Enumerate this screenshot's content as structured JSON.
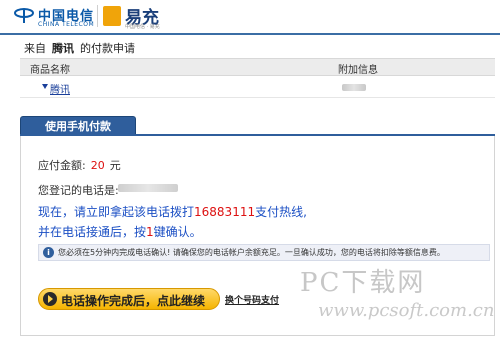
{
  "header": {
    "telecom_name": "中国电信",
    "telecom_en": "CHINA TELECOM",
    "yichong_name": "易充",
    "yichong_sub": "中国电信 · 易充"
  },
  "merchant": {
    "prefix": "来自",
    "name": "腾讯",
    "suffix": "的付款申请"
  },
  "table": {
    "columns": [
      "商品名称",
      "附加信息"
    ],
    "row": {
      "product_link": "腾讯"
    }
  },
  "tab": {
    "label": "使用手机付款"
  },
  "payment": {
    "amount_label": "应付金额:",
    "amount_value": "20",
    "amount_unit": "元",
    "phone_label": "您登记的电话是:"
  },
  "instructions": {
    "line1_prefix": "现在，请立即拿起该电话拨打",
    "hotline_number": "16883111",
    "line1_suffix": "支付热线,",
    "line2_prefix": "并在电话接通后，按",
    "key": "1",
    "line2_suffix": "键确认。"
  },
  "notice": {
    "icon_text": "i",
    "text": "您必须在5分钟内完成电话确认! 请确保您的电话帐户余额充足。一旦确认成功，您的电话将扣除等额信息费。"
  },
  "actions": {
    "continue_label": "电话操作完成后，点此继续",
    "alt_pay_label": "换个号码支付"
  },
  "watermark": {
    "title": "PC下载网",
    "url": "www.pcsoft.com.cn"
  },
  "colors": {
    "accent": "#2f5e9c",
    "link": "#1b4fc4",
    "highlight": "#dd1111",
    "button": "#f5b400"
  }
}
